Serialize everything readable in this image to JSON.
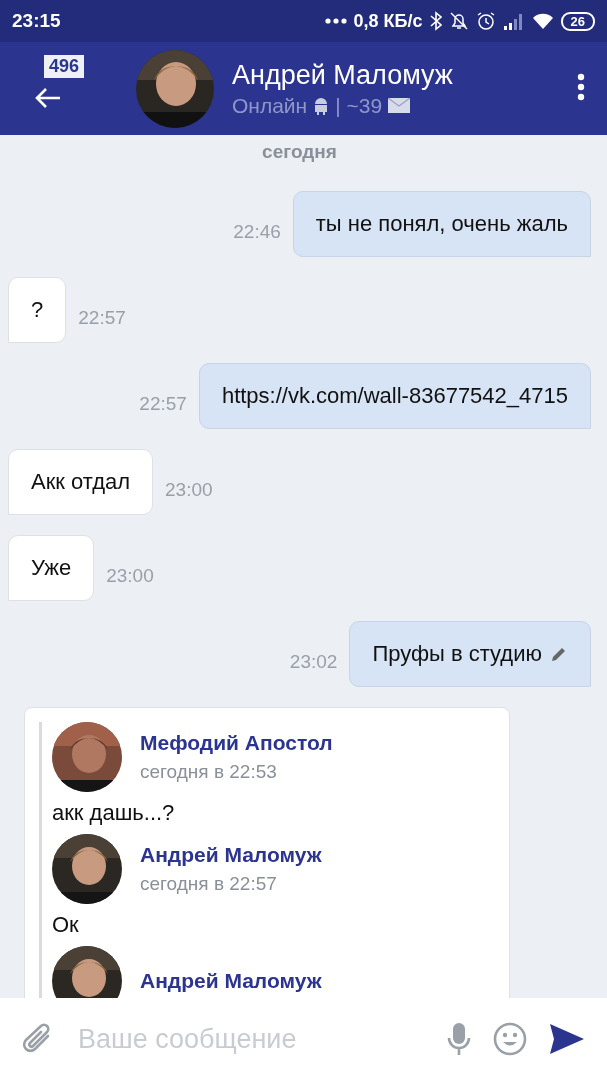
{
  "status_bar": {
    "time": "23:15",
    "speed": "0,8 КБ/с",
    "battery": "26"
  },
  "header": {
    "unread_badge": "496",
    "name": "Андрей Маломуж",
    "status": "Онлайн",
    "counter": "| ~39"
  },
  "date_label": "сегодня",
  "messages": [
    {
      "kind": "out",
      "text": "ты не понял, очень жаль",
      "time": "22:46",
      "edited": false
    },
    {
      "kind": "in",
      "text": "?",
      "time": "22:57",
      "edited": false
    },
    {
      "kind": "out",
      "text": "https://vk.com/wall-83677542_4715",
      "time": "22:57",
      "edited": false
    },
    {
      "kind": "in",
      "text": "Акк отдал",
      "time": "23:00",
      "edited": false
    },
    {
      "kind": "in",
      "text": "Уже",
      "time": "23:00",
      "edited": false
    },
    {
      "kind": "out",
      "text": "Пруфы в студию",
      "time": "23:02",
      "edited": true
    },
    {
      "kind": "forward",
      "forwarded": [
        {
          "author": "Мефодий Апостол",
          "date": "сегодня в 22:53",
          "text": "акк дашь...?"
        },
        {
          "author": "Андрей Маломуж",
          "date": "сегодня в 22:57",
          "text": "Ок"
        },
        {
          "author": "Андрей Маломуж"
        }
      ]
    }
  ],
  "composer": {
    "placeholder": "Ваше сообщение"
  }
}
